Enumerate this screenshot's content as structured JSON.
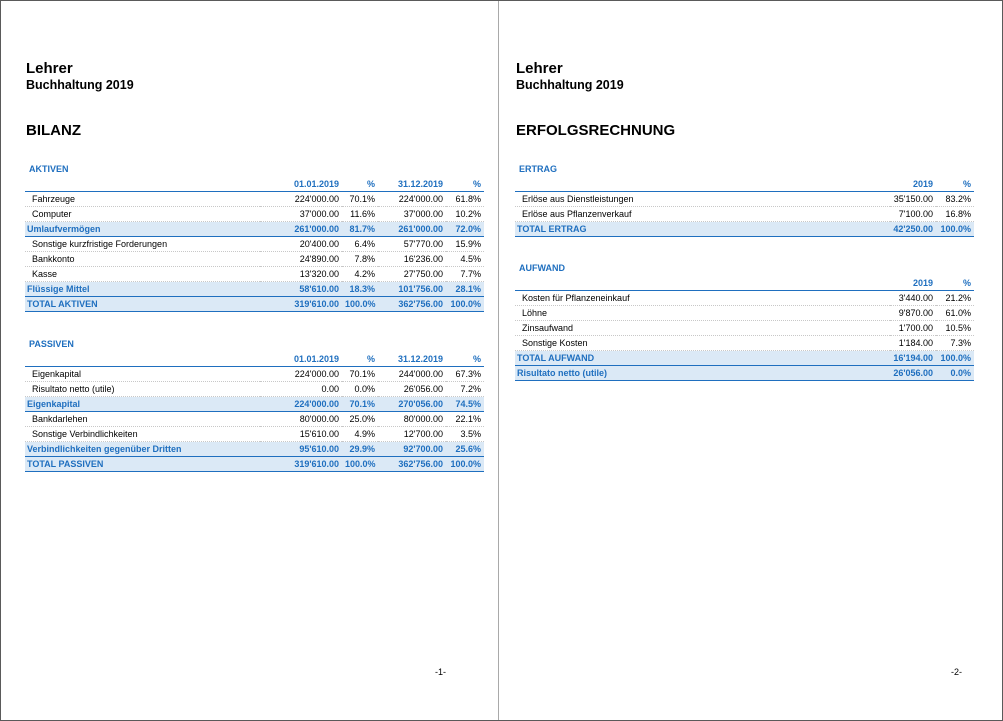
{
  "colors": {
    "accent": "#1f6fbf",
    "subtotal_bg": "#dbe9f6"
  },
  "page1": {
    "title": "Lehrer",
    "subtitle": "Buchhaltung 2019",
    "section": "BILANZ",
    "aktiven": {
      "group": "AKTIVEN",
      "headers": [
        "",
        "01.01.2019",
        "%",
        "31.12.2019",
        "%"
      ],
      "rows": [
        {
          "type": "row",
          "cells": [
            "Fahrzeuge",
            "224'000.00",
            "70.1%",
            "224'000.00",
            "61.8%"
          ]
        },
        {
          "type": "row",
          "cells": [
            "Computer",
            "37'000.00",
            "11.6%",
            "37'000.00",
            "10.2%"
          ]
        },
        {
          "type": "sub",
          "cells": [
            "Umlaufvermögen",
            "261'000.00",
            "81.7%",
            "261'000.00",
            "72.0%"
          ]
        },
        {
          "type": "row",
          "cells": [
            "Sonstige kurzfristige Forderungen",
            "20'400.00",
            "6.4%",
            "57'770.00",
            "15.9%"
          ]
        },
        {
          "type": "row",
          "cells": [
            "Bankkonto",
            "24'890.00",
            "7.8%",
            "16'236.00",
            "4.5%"
          ]
        },
        {
          "type": "row",
          "cells": [
            "Kasse",
            "13'320.00",
            "4.2%",
            "27'750.00",
            "7.7%"
          ]
        },
        {
          "type": "sub",
          "cells": [
            "Flüssige Mittel",
            "58'610.00",
            "18.3%",
            "101'756.00",
            "28.1%"
          ]
        },
        {
          "type": "sub",
          "cells": [
            "TOTAL AKTIVEN",
            "319'610.00",
            "100.0%",
            "362'756.00",
            "100.0%"
          ]
        }
      ]
    },
    "passiven": {
      "group": "PASSIVEN",
      "headers": [
        "",
        "01.01.2019",
        "%",
        "31.12.2019",
        "%"
      ],
      "rows": [
        {
          "type": "row",
          "cells": [
            "Eigenkapital",
            "224'000.00",
            "70.1%",
            "244'000.00",
            "67.3%"
          ]
        },
        {
          "type": "row",
          "cells": [
            "Risultato netto (utile)",
            "0.00",
            "0.0%",
            "26'056.00",
            "7.2%"
          ]
        },
        {
          "type": "sub",
          "cells": [
            "Eigenkapital",
            "224'000.00",
            "70.1%",
            "270'056.00",
            "74.5%"
          ]
        },
        {
          "type": "row",
          "cells": [
            "Bankdarlehen",
            "80'000.00",
            "25.0%",
            "80'000.00",
            "22.1%"
          ]
        },
        {
          "type": "row",
          "cells": [
            "Sonstige Verbindlichkeiten",
            "15'610.00",
            "4.9%",
            "12'700.00",
            "3.5%"
          ]
        },
        {
          "type": "sub",
          "cells": [
            "Verbindlichkeiten gegenüber Dritten",
            "95'610.00",
            "29.9%",
            "92'700.00",
            "25.6%"
          ]
        },
        {
          "type": "sub",
          "cells": [
            "TOTAL PASSIVEN",
            "319'610.00",
            "100.0%",
            "362'756.00",
            "100.0%"
          ]
        }
      ]
    },
    "page_number": "-1-"
  },
  "page2": {
    "title": "Lehrer",
    "subtitle": "Buchhaltung 2019",
    "section": "ERFOLGSRECHNUNG",
    "ertrag": {
      "group": "ERTRAG",
      "headers": [
        "",
        "2019",
        "%"
      ],
      "rows": [
        {
          "type": "row",
          "cells": [
            "Erlöse aus Dienstleistungen",
            "35'150.00",
            "83.2%"
          ]
        },
        {
          "type": "row",
          "cells": [
            "Erlöse aus Pflanzenverkauf",
            "7'100.00",
            "16.8%"
          ]
        },
        {
          "type": "sub",
          "cells": [
            "TOTAL ERTRAG",
            "42'250.00",
            "100.0%"
          ]
        }
      ]
    },
    "aufwand": {
      "group": "AUFWAND",
      "headers": [
        "",
        "2019",
        "%"
      ],
      "rows": [
        {
          "type": "row",
          "cells": [
            "Kosten für Pflanzeneinkauf",
            "3'440.00",
            "21.2%"
          ]
        },
        {
          "type": "row",
          "cells": [
            "Löhne",
            "9'870.00",
            "61.0%"
          ]
        },
        {
          "type": "row",
          "cells": [
            "Zinsaufwand",
            "1'700.00",
            "10.5%"
          ]
        },
        {
          "type": "row",
          "cells": [
            "Sonstige Kosten",
            "1'184.00",
            "7.3%"
          ]
        },
        {
          "type": "sub",
          "cells": [
            "TOTAL AUFWAND",
            "16'194.00",
            "100.0%"
          ]
        },
        {
          "type": "sub",
          "cells": [
            "Risultato netto (utile)",
            "26'056.00",
            "0.0%"
          ]
        }
      ]
    },
    "page_number": "-2-"
  }
}
